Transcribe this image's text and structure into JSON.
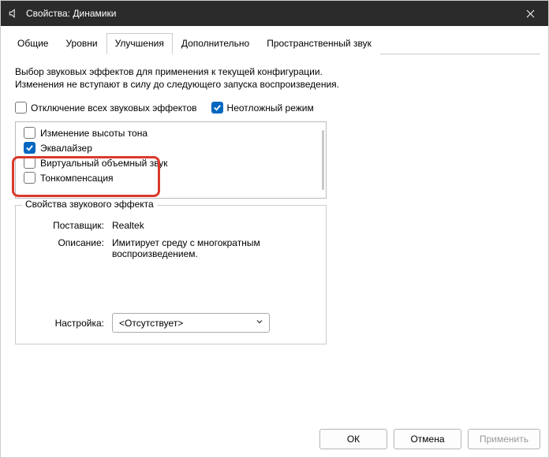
{
  "window": {
    "title": "Свойства: Динамики"
  },
  "tabs": {
    "t0": "Общие",
    "t1": "Уровни",
    "t2": "Улучшения",
    "t3": "Дополнительно",
    "t4": "Пространственный звук"
  },
  "intro": "Выбор звуковых эффектов для применения к текущей конфигурации. Изменения не вступают в силу до следующего запуска воспроизведения.",
  "top_checks": {
    "disable_all": "Отключение всех звуковых эффектов",
    "urgent": "Неотложный режим"
  },
  "effects": {
    "e0": "Изменение высоты тона",
    "e1": "Эквалайзер",
    "e2": "Виртуальный объемный звук",
    "e3": "Тонкомпенсация"
  },
  "group": {
    "legend": "Свойства звукового эффекта",
    "provider_label": "Поставщик:",
    "provider_value": "Realtek",
    "desc_label": "Описание:",
    "desc_value": "Имитирует среду с многократным воспроизведением.",
    "setting_label": "Настройка:",
    "setting_value": "<Отсутствует>"
  },
  "buttons": {
    "ok": "ОК",
    "cancel": "Отмена",
    "apply": "Применить"
  }
}
